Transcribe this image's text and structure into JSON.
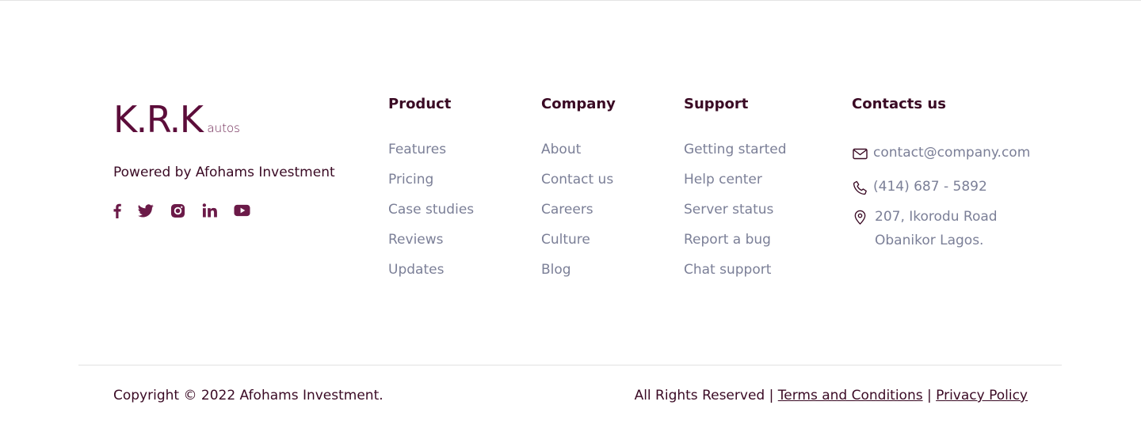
{
  "brand": {
    "logo_main": "K.R.K",
    "logo_sub": "autos",
    "tagline": "Powered by Afohams Investment"
  },
  "socials": [
    {
      "icon": "facebook-icon"
    },
    {
      "icon": "twitter-icon"
    },
    {
      "icon": "instagram-icon"
    },
    {
      "icon": "linkedin-icon"
    },
    {
      "icon": "youtube-icon"
    }
  ],
  "product": {
    "title": "Product",
    "items": [
      "Features",
      "Pricing",
      "Case studies",
      "Reviews",
      "Updates"
    ]
  },
  "company": {
    "title": "Company",
    "items": [
      "About",
      "Contact us",
      "Careers",
      "Culture",
      "Blog"
    ]
  },
  "support": {
    "title": "Support",
    "items": [
      "Getting started",
      "Help center",
      "Server status",
      "Report a bug",
      "Chat support"
    ]
  },
  "contacts": {
    "title": "Contacts us",
    "email": "contact@company.com",
    "phone": "(414) 687 - 5892",
    "address_line1": "207, Ikorodu Road",
    "address_line2": "Obanikor Lagos."
  },
  "footer": {
    "copyright": "Copyright © 2022 Afohams Investment.",
    "rights": "All Rights Reserved",
    "separator": "|",
    "terms": "Terms and Conditions",
    "privacy": "Privacy Policy"
  },
  "colors": {
    "brand": "#5c0d3a",
    "text_dark": "#3a0a24",
    "text_muted": "#7b7f97",
    "divider": "#e2e2e2"
  }
}
